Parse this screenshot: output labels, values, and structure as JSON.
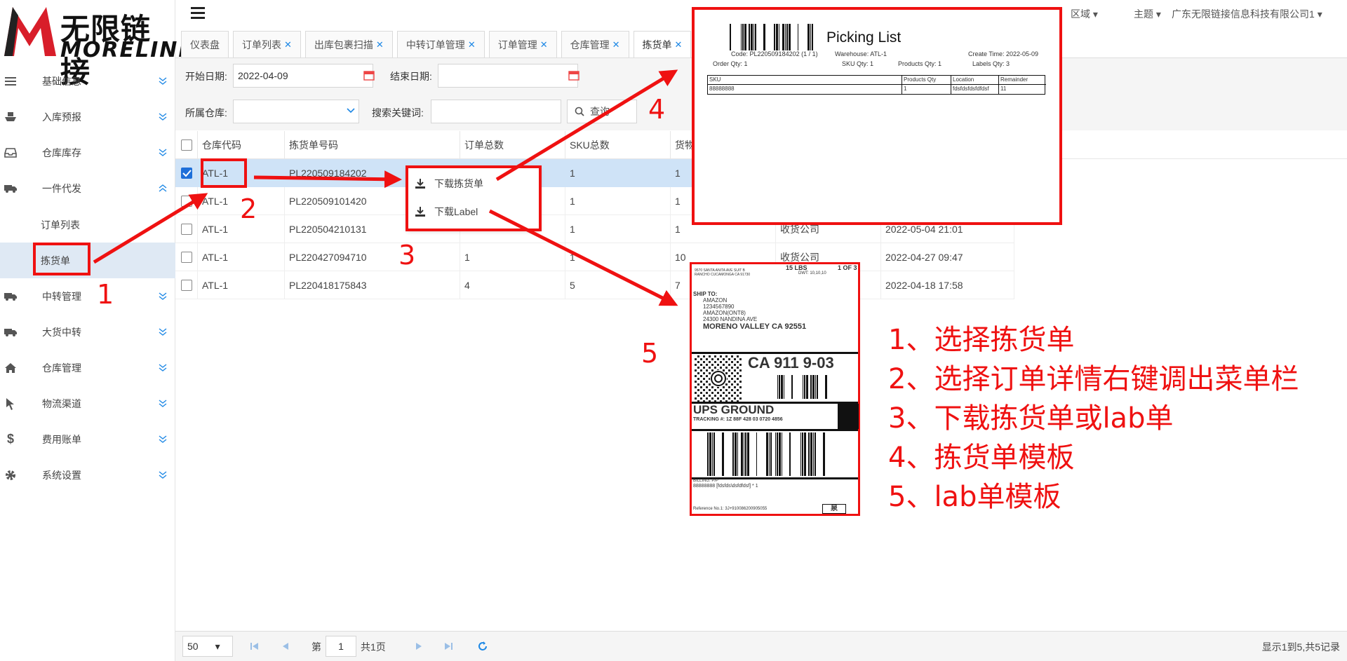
{
  "logo": {
    "cn": "无限链接",
    "en": "MORELINK"
  },
  "topbar": {
    "region": "区域",
    "theme": "主题",
    "company": "广东无限链接信息科技有限公司1"
  },
  "sidebar": {
    "items": [
      {
        "label": "基础信息",
        "icon": "menu-icon"
      },
      {
        "label": "入库预报",
        "icon": "ship-icon"
      },
      {
        "label": "仓库库存",
        "icon": "inbox-icon"
      },
      {
        "label": "一件代发",
        "icon": "truck-icon"
      },
      {
        "label": "中转管理",
        "icon": "truck-icon"
      },
      {
        "label": "大货中转",
        "icon": "truck-icon"
      },
      {
        "label": "仓库管理",
        "icon": "home-icon"
      },
      {
        "label": "物流渠道",
        "icon": "cursor-icon"
      },
      {
        "label": "费用账单",
        "icon": "dollar-icon"
      },
      {
        "label": "系统设置",
        "icon": "gear-icon"
      }
    ],
    "subitems": [
      "订单列表",
      "拣货单"
    ]
  },
  "tabs": [
    "仪表盘",
    "订单列表",
    "出库包裹扫描",
    "中转订单管理",
    "订单管理",
    "仓库管理",
    "拣货单"
  ],
  "filter": {
    "start_label": "开始日期:",
    "start_value": "2022-04-09",
    "end_label": "结束日期:",
    "warehouse_label": "所属仓库:",
    "keyword_label": "搜索关键词:",
    "search_btn": "查询"
  },
  "table": {
    "headers": [
      "仓库代码",
      "拣货单号码",
      "订单总数",
      "SKU总数",
      "货物"
    ],
    "rows": [
      [
        "ATL-1",
        "PL220509184202",
        "",
        "1",
        "1",
        "",
        ""
      ],
      [
        "ATL-1",
        "PL220509101420",
        "",
        "1",
        "1",
        "",
        ""
      ],
      [
        "ATL-1",
        "PL220504210131",
        "",
        "1",
        "1",
        "收货公司",
        "2022-05-04 21:01"
      ],
      [
        "ATL-1",
        "PL220427094710",
        "1",
        "1",
        "10",
        "收货公司",
        "2022-04-27 09:47"
      ],
      [
        "ATL-1",
        "PL220418175843",
        "4",
        "5",
        "7",
        "",
        "2022-04-18 17:58"
      ]
    ]
  },
  "context_menu": {
    "items": [
      "下载拣货单",
      "下载Label"
    ]
  },
  "pager": {
    "page_size": "50",
    "page_prefix": "第",
    "page": "1",
    "page_suffix": "共1页",
    "summary": "显示1到5,共5记录"
  },
  "picking_list": {
    "title": "Picking List",
    "code": "Code: PL220509184202 (1 / 1)",
    "warehouse": "Warehouse: ATL-1",
    "create_time": "Create Time: 2022-05-09",
    "order_qty": "Order Qty: 1",
    "sku_qty": "SKU Qty: 1",
    "products_qty": "Products Qty: 1",
    "labels_qty": "Labels Qty: 3",
    "headers": [
      "SKU",
      "Products Qty",
      "Location",
      "Remainder"
    ],
    "row": [
      "88888888",
      "1",
      "fdsfdsfdsfdfdsf",
      "11"
    ]
  },
  "label": {
    "weight": "15 LBS",
    "pages": "1 OF 3",
    "from": "9570 SANTA ANITA AVE SUIT B",
    "from2": "RANCHO CUCAMONGA CA 91730",
    "dwt": "DWT: 10,10,10",
    "ship_to": "SHIP TO:",
    "to1": "AMAZON",
    "to2": "1234567890",
    "to3": "AMAZON(ONT8)",
    "to4": "24300 NANDINA AVE",
    "to5": "MORENO VALLEY CA 92551",
    "zip": "CA 911 9-03",
    "service": "UPS GROUND",
    "tracking": "TRACKING #: 1Z 88F 428 03 0720 4856",
    "billing": "BILLING: P/P",
    "sku_line": "88888888 [fdsfds\\dsfdfdsf] * 1",
    "reference": "Reference No.1: 3J+910086200905055",
    "mark": "泉"
  },
  "annotations": {
    "n1": "1",
    "n2": "2",
    "n3": "3",
    "n4": "4",
    "n5": "5",
    "notes": [
      "1、选择拣货单",
      "2、选择订单详情右键调出菜单栏",
      "3、下载拣货单或lab单",
      "4、拣货单模板",
      "5、lab单模板"
    ]
  },
  "colors": {
    "annotation": "#ef1111",
    "selected_row": "#cfe3f7",
    "accent": "#1e88e5"
  }
}
